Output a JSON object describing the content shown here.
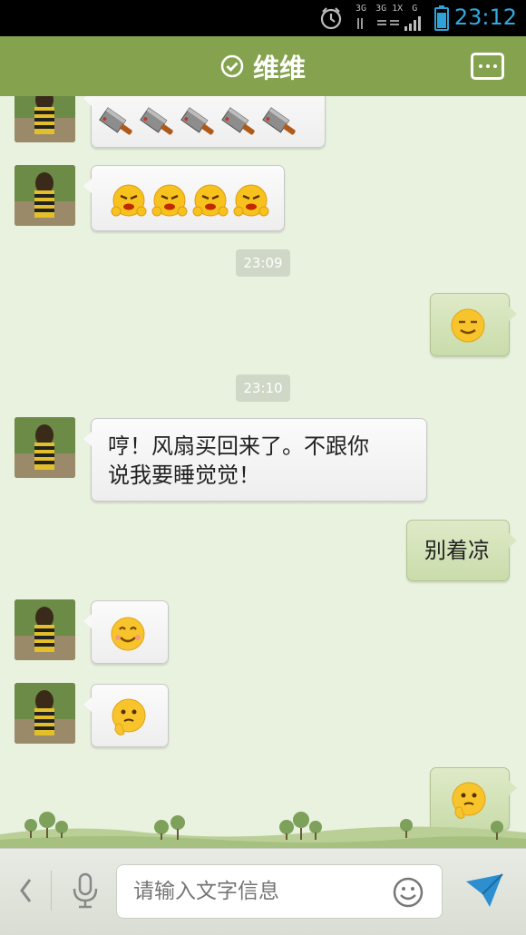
{
  "status_bar": {
    "time": "23:12",
    "network_label_1": "3G",
    "network_label_2": "3G 1X",
    "network_label_3": "G",
    "icons": [
      "alarm-icon",
      "signal-icon",
      "battery-icon"
    ]
  },
  "header": {
    "title": "维维",
    "status_icon": "check-circle-icon",
    "menu_icon": "more-icon",
    "color": "#85a34f"
  },
  "messages": [
    {
      "direction": "in",
      "type": "emoji",
      "emoji": [
        "knife",
        "knife",
        "knife",
        "knife",
        "knife"
      ]
    },
    {
      "direction": "in",
      "type": "emoji",
      "emoji": [
        "angry-face",
        "angry-face",
        "angry-face",
        "angry-face"
      ]
    },
    {
      "type": "timestamp",
      "text": "23:09"
    },
    {
      "direction": "out",
      "type": "emoji",
      "emoji": [
        "content-face"
      ]
    },
    {
      "type": "timestamp",
      "text": "23:10"
    },
    {
      "direction": "in",
      "type": "text",
      "text": "哼！风扇买回来了。不跟你\n说我要睡觉觉！"
    },
    {
      "direction": "out",
      "type": "text",
      "text": "别着凉"
    },
    {
      "direction": "in",
      "type": "emoji",
      "emoji": [
        "smile-face"
      ]
    },
    {
      "direction": "in",
      "type": "emoji",
      "emoji": [
        "thinking-face"
      ]
    },
    {
      "direction": "out",
      "type": "emoji",
      "emoji": [
        "thinking-face"
      ]
    }
  ],
  "input_bar": {
    "placeholder": "请输入文字信息",
    "icons": [
      "chevron-left-icon",
      "microphone-icon",
      "emoji-icon",
      "send-icon"
    ]
  },
  "colors": {
    "chat_background": "#e9f1df",
    "outgoing_bubble": "#d3e2b7",
    "incoming_bubble": "#f4f4f4",
    "time_accent": "#33a9e0"
  }
}
